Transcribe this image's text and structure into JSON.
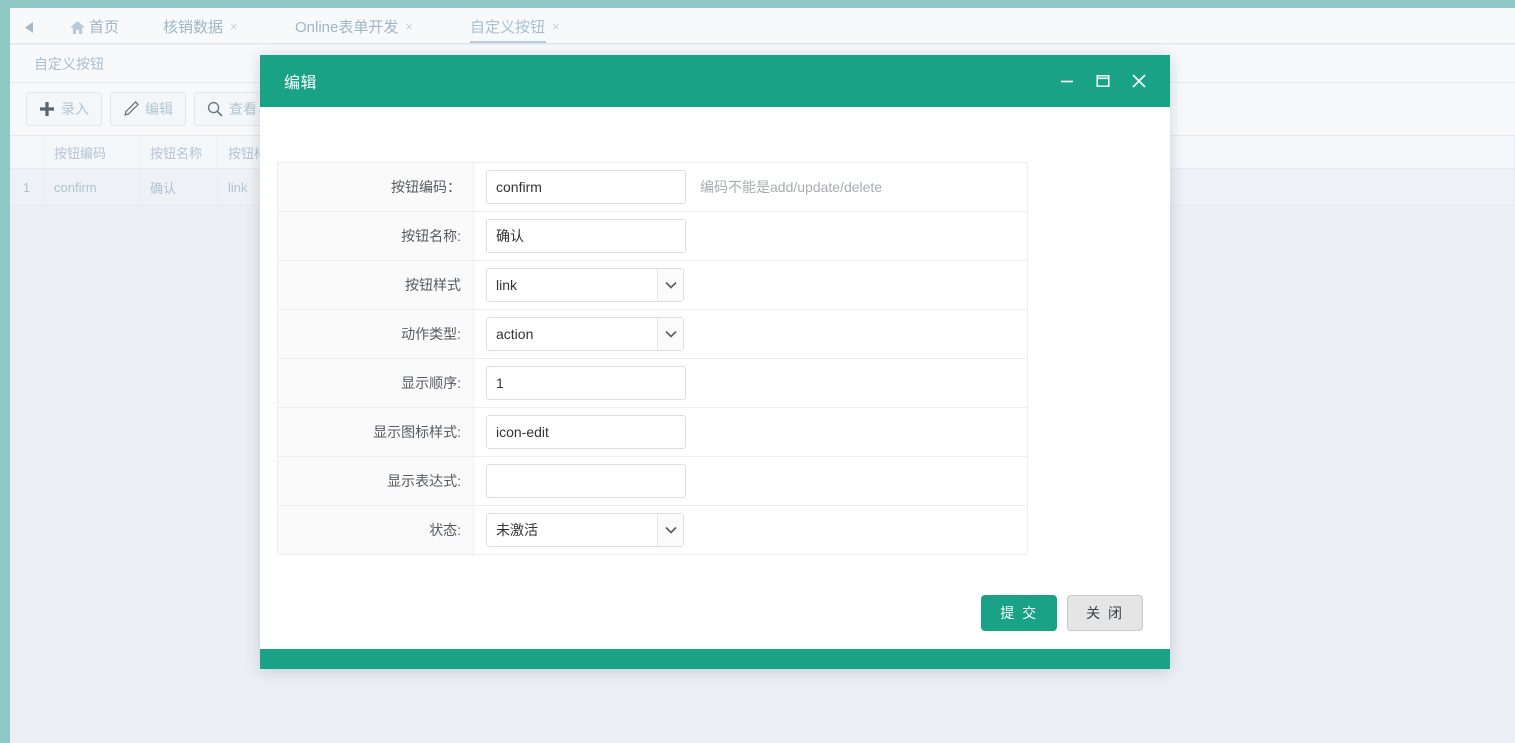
{
  "theme": {
    "accent": "#1aa287",
    "edge_strip": "#8fc9c6",
    "page_bg": "#eceff5",
    "panel_bg": "#f7f9fb",
    "tab_text": "#9fb6c6",
    "tab_underline": "#b6cfda"
  },
  "tabbar": {
    "scroll_left_icon": "caret-left-icon",
    "tabs": [
      {
        "label": "首页",
        "icon": "home-icon",
        "closable": false,
        "active": false
      },
      {
        "label": "核销数据",
        "icon": "",
        "closable": true,
        "active": false
      },
      {
        "label": "Online表单开发",
        "icon": "",
        "closable": true,
        "active": false
      },
      {
        "label": "自定义按钮",
        "icon": "",
        "closable": true,
        "active": true
      }
    ],
    "close_glyph": "×"
  },
  "content": {
    "title": "自定义按钮",
    "toolbar": [
      {
        "label": "录入",
        "icon": "plus-icon"
      },
      {
        "label": "编辑",
        "icon": "pencil-icon"
      },
      {
        "label": "查看",
        "icon": "search-icon"
      }
    ],
    "table": {
      "columns": [
        "",
        "按钮编码",
        "按钮名称",
        "按钮样"
      ],
      "rows": [
        {
          "index": "1",
          "code": "confirm",
          "name": "确认",
          "style": "link"
        }
      ]
    }
  },
  "modal": {
    "title": "编辑",
    "window_controls": [
      {
        "name": "minimize-button",
        "glyph": "—"
      },
      {
        "name": "maximize-button",
        "glyph": "❐"
      },
      {
        "name": "close-button",
        "glyph": "✕"
      }
    ],
    "fields": [
      {
        "label": "按钮编码：",
        "type": "text",
        "value": "confirm",
        "hint": "编码不能是add/update/delete"
      },
      {
        "label": "按钮名称:",
        "type": "text",
        "value": "确认",
        "hint": ""
      },
      {
        "label": "按钮样式",
        "type": "select",
        "value": "link",
        "hint": ""
      },
      {
        "label": "动作类型:",
        "type": "select",
        "value": "action",
        "hint": ""
      },
      {
        "label": "显示顺序:",
        "type": "text",
        "value": "1",
        "hint": ""
      },
      {
        "label": "显示图标样式:",
        "type": "text",
        "value": "icon-edit",
        "hint": ""
      },
      {
        "label": "显示表达式:",
        "type": "text",
        "value": "",
        "hint": ""
      },
      {
        "label": "状态:",
        "type": "select",
        "value": "未激活",
        "hint": ""
      }
    ],
    "buttons": {
      "submit": "提 交",
      "close": "关 闭"
    }
  }
}
